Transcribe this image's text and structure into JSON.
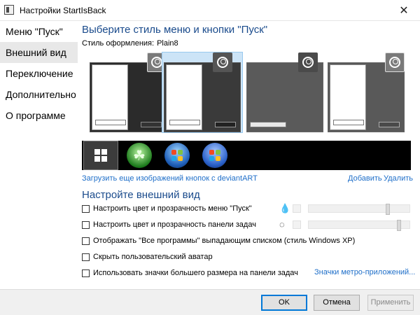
{
  "window": {
    "title": "Настройки StartIsBack",
    "close_icon": "close-icon"
  },
  "sidebar": {
    "items": [
      {
        "label": "Меню \"Пуск\"",
        "active": false
      },
      {
        "label": "Внешний вид",
        "active": true
      },
      {
        "label": "Переключение",
        "active": false
      },
      {
        "label": "Дополнительно",
        "active": false
      },
      {
        "label": "О программе",
        "active": false
      }
    ]
  },
  "style_section": {
    "title": "Выберите стиль меню и кнопки \"Пуск\"",
    "style_label": "Стиль оформления:",
    "style_value": "Plain8",
    "previews": [
      {
        "name": "style-dark",
        "selected": false
      },
      {
        "name": "style-light",
        "selected": true
      },
      {
        "name": "style-gray",
        "selected": false
      },
      {
        "name": "style-white-gray",
        "selected": false
      }
    ],
    "start_buttons": [
      "windows10-logo",
      "clover-orb",
      "windows7-orb",
      "windows7-orb-alt"
    ],
    "more_link": "Загрузить еще изображений кнопок с deviantART",
    "add_link": "Добавить",
    "remove_link": "Удалить"
  },
  "appearance_section": {
    "title": "Настройте внешний вид",
    "options": [
      {
        "label": "Настроить цвет и прозрачность меню \"Пуск\"",
        "checked": false
      },
      {
        "label": "Настроить цвет и прозрачность панели задач",
        "checked": false
      },
      {
        "label": "Отображать \"Все программы\" выпадающим списком (стиль Windows XP)",
        "checked": false
      },
      {
        "label": "Скрыть пользовательский аватар",
        "checked": false
      },
      {
        "label": "Использовать значки большего размера на панели задач",
        "checked": false
      }
    ],
    "sliders": [
      {
        "icon": "filled-drop-icon",
        "value": 0.8
      },
      {
        "icon": "outline-drop-icon",
        "value": 0.91
      }
    ],
    "metro_link": "Значки метро-приложений..."
  },
  "footer": {
    "ok": "OK",
    "cancel": "Отмена",
    "apply": "Применить"
  }
}
